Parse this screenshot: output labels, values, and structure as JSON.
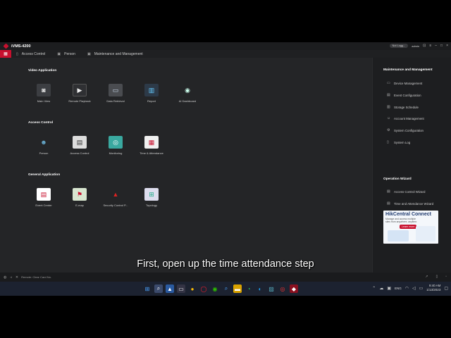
{
  "app": {
    "title": "iVMS-4200",
    "login_status": "Not Logg...",
    "user": "admin"
  },
  "tabs": [
    {
      "label": "Access Control",
      "icon": "door-icon"
    },
    {
      "label": "Person",
      "icon": "person-icon"
    },
    {
      "label": "Maintenance and Management",
      "icon": "wrench-icon"
    }
  ],
  "sections": {
    "video": {
      "title": "Video Application",
      "items": [
        {
          "label": "Main View",
          "icon": "camera-icon"
        },
        {
          "label": "Remote Playback",
          "icon": "playback-icon"
        },
        {
          "label": "Data Retrieval",
          "icon": "monitor-icon"
        },
        {
          "label": "Report",
          "icon": "report-chart-icon"
        },
        {
          "label": "AI Dashboard",
          "icon": "ai-robot-icon"
        }
      ]
    },
    "access": {
      "title": "Access Control",
      "items": [
        {
          "label": "Person",
          "icon": "person-icon"
        },
        {
          "label": "Access Control",
          "icon": "door-icon"
        },
        {
          "label": "Monitoring",
          "icon": "monitoring-icon"
        },
        {
          "label": "Time & Attendance",
          "icon": "calendar-icon"
        }
      ]
    },
    "general": {
      "title": "General Application",
      "items": [
        {
          "label": "Event Center",
          "icon": "event-center-icon"
        },
        {
          "label": "E-map",
          "icon": "map-icon"
        },
        {
          "label": "Security Control P...",
          "icon": "alarm-icon"
        },
        {
          "label": "Topology",
          "icon": "topology-icon"
        }
      ]
    }
  },
  "right_panel": {
    "maintenance_title": "Maintenance and Management",
    "maintenance_items": [
      {
        "label": "Device Management",
        "icon": "device-icon"
      },
      {
        "label": "Event Configuration",
        "icon": "event-config-icon"
      },
      {
        "label": "Storage Schedule",
        "icon": "storage-icon"
      },
      {
        "label": "Account Management",
        "icon": "account-icon"
      },
      {
        "label": "System Configuration",
        "icon": "gear-icon"
      },
      {
        "label": "System Log",
        "icon": "log-icon"
      }
    ],
    "wizard_title": "Operation Wizard",
    "wizard_items": [
      {
        "label": "Access Control Wizard",
        "icon": "wizard-icon"
      },
      {
        "label": "Time and Attendance Wizard",
        "icon": "wizard-icon"
      }
    ],
    "promo": {
      "title": "HikCentral Connect",
      "subtitle": "Manage and access multiple sites from anywhere, anytime.",
      "button": "Learn more"
    }
  },
  "statusbar": {
    "text": "Remote: Clear Card No."
  },
  "subtitle": "First, open up the time attendance step",
  "taskbar": {
    "lang": "ENG",
    "time": "9:40 AM",
    "date": "1/13/2023"
  }
}
